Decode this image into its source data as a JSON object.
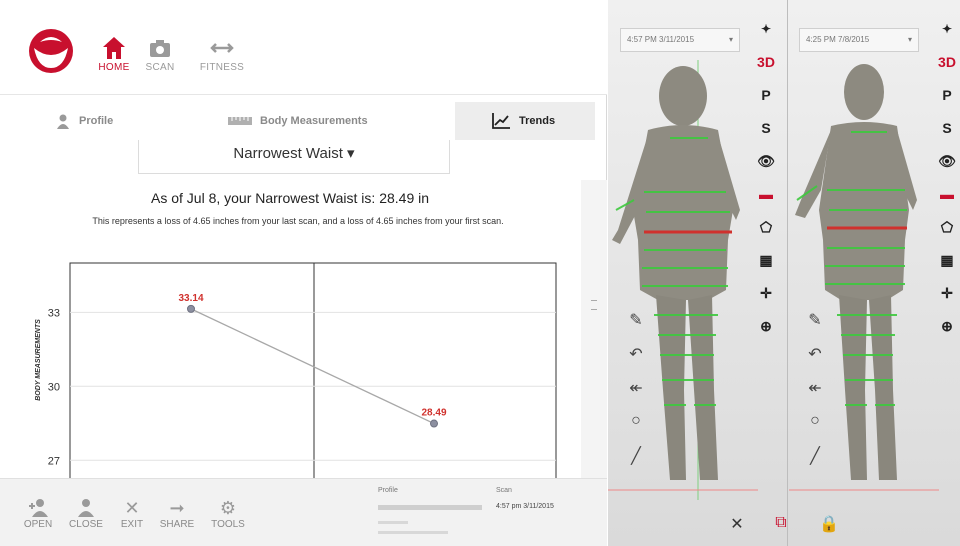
{
  "nav": {
    "home": "HOME",
    "scan": "SCAN",
    "fitness": "FITNESS"
  },
  "tabs": {
    "profile": "Profile",
    "body_measurements": "Body Measurements",
    "trends": "Trends"
  },
  "metric": {
    "selected": "Narrowest Waist",
    "caret": "▾"
  },
  "summary": {
    "headline": "As of Jul 8, your Narrowest Waist is: 28.49 in",
    "detail": "This represents a loss of 4.65 inches from your last scan, and a loss of 4.65 inches from your first scan."
  },
  "chart_data": {
    "type": "line",
    "ylabel": "BODY MEASUREMENTS",
    "xlabel": "",
    "yticks": [
      33,
      30,
      27
    ],
    "ylim": [
      26.2,
      35
    ],
    "x": [
      0,
      1
    ],
    "values": [
      33.14,
      28.49
    ],
    "labels": [
      "33.14",
      "28.49"
    ],
    "grid": true,
    "colors": {
      "line": "#a8a8a8",
      "point": "#8c8fa0",
      "label": "#d0312d"
    }
  },
  "bottom": {
    "open": "OPEN",
    "close": "CLOSE",
    "exit": "EXIT",
    "share": "SHARE",
    "tools": "TOOLS"
  },
  "scan_info": {
    "profile_label": "Profile",
    "scan_label": "Scan",
    "scan_value": "4:57 pm 3/11/2015"
  },
  "viewer": {
    "pane1_date": "4:57 PM 3/11/2015",
    "pane2_date": "4:25 PM 7/8/2015",
    "tools": [
      "3D",
      "P",
      "S"
    ],
    "left_tools": [
      "pencil-icon",
      "undo-icon",
      "circle-icon",
      "line-icon"
    ]
  },
  "colors": {
    "accent": "#c8102e",
    "measure_line": "#3ec93e",
    "waist_line": "#d0312d"
  }
}
